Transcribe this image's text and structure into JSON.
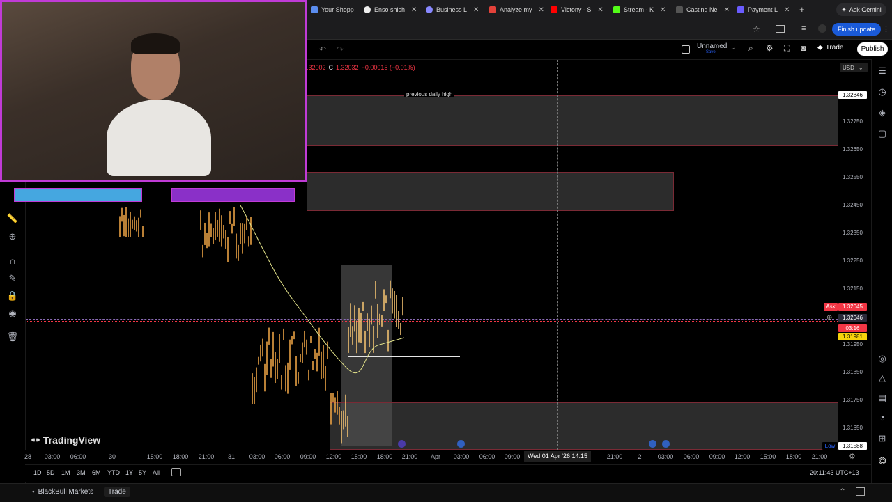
{
  "browser": {
    "tabs": [
      {
        "label": "Your Shopp",
        "color": "#5b8def"
      },
      {
        "label": "Enso shish",
        "color": "#111111"
      },
      {
        "label": "Business L",
        "color": "#8888ff"
      },
      {
        "label": "Analyze my",
        "color": "#e4423a"
      },
      {
        "label": "Victony - S",
        "color": "#ff0000"
      },
      {
        "label": "Stream - K",
        "color": "#53fc18"
      },
      {
        "label": "Casting Ne",
        "color": "#555555"
      },
      {
        "label": "Payment L",
        "color": "#6a5cff"
      }
    ],
    "new_tab": "+",
    "ask_gemini": "Ask Gemini",
    "finish_update": "Finish update"
  },
  "toolbar": {
    "layout_name": "Unnamed",
    "layout_status": "Save",
    "trade": "Trade",
    "publish": "Publish"
  },
  "legend": {
    "ohlc_partial": ".32002",
    "close_label": "C",
    "close": "1.32032",
    "change": "−0.00015 (−0.01%)"
  },
  "currency": "USD",
  "annotations": {
    "prev_daily_high": "previous daily high"
  },
  "price_axis": [
    "1.32750",
    "1.32650",
    "1.32550",
    "1.32450",
    "1.32350",
    "1.32250",
    "1.32150",
    "1.31950",
    "1.31850",
    "1.31750",
    "1.31650"
  ],
  "price_tags": {
    "high_line": "1.32846",
    "ask_label": "Ask",
    "ask": "1.32045",
    "crosshair": "1.32046",
    "countdown": "03:16",
    "bid": "1.31981",
    "low_label": "Low",
    "low": "1.31588"
  },
  "time_axis": [
    "28",
    "03:00",
    "06:00",
    "30",
    "15:00",
    "18:00",
    "21:00",
    "31",
    "03:00",
    "06:00",
    "09:00",
    "12:00",
    "15:00",
    "18:00",
    "21:00",
    "Apr",
    "03:00",
    "06:00",
    "09:00",
    "21:00",
    "2",
    "03:00",
    "06:00",
    "09:00",
    "12:00",
    "15:00",
    "18:00",
    "21:00"
  ],
  "crosshair_time": "Wed 01 Apr '26   14:15",
  "watermark": "TradingView",
  "ranges": [
    "1D",
    "5D",
    "1M",
    "3M",
    "6M",
    "YTD",
    "1Y",
    "5Y",
    "All"
  ],
  "clock": "20:11:43 UTC+13",
  "footer": {
    "broker": "BlackBull Markets",
    "trade": "Trade"
  },
  "colors": {
    "candle": "#e8a043",
    "ma": "#e3e38a",
    "zone_border": "#7a2a35",
    "ask": "#f23645",
    "bid": "#f5d20c",
    "webcam_border": "#c03bd6"
  },
  "icons": [
    "ruler-icon",
    "zoom-icon",
    "magnet-icon",
    "pencil-icon",
    "lock-icon",
    "eye-icon",
    "trash-icon",
    "star-icon",
    "camera-icon",
    "fullscreen-icon",
    "settings-icon",
    "undo-icon",
    "redo-icon"
  ]
}
